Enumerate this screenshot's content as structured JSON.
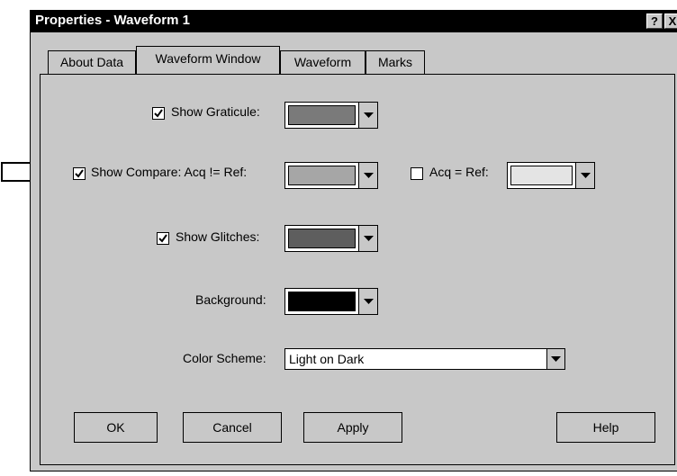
{
  "window": {
    "title": "Properties - Waveform 1",
    "help_glyph": "?",
    "close_glyph": "X"
  },
  "tabs": [
    {
      "label": "About Data",
      "active": false
    },
    {
      "label": "Waveform Window",
      "active": true
    },
    {
      "label": "Waveform",
      "active": false
    },
    {
      "label": "Marks",
      "active": false
    }
  ],
  "options": {
    "graticule": {
      "label": "Show Graticule:",
      "checked": true,
      "color": "#7a7a7a"
    },
    "compare": {
      "label": "Show Compare: Acq != Ref:",
      "checked": true,
      "color": "#a6a6a6"
    },
    "acq_eq_ref": {
      "label": "Acq = Ref:",
      "checked": false,
      "color": "#e4e4e4"
    },
    "glitches": {
      "label": "Show Glitches:",
      "checked": true,
      "color": "#5e5e5e"
    },
    "background": {
      "label": "Background:",
      "color": "#000000"
    },
    "color_scheme": {
      "label": "Color Scheme:",
      "value": "Light on Dark"
    }
  },
  "buttons": {
    "ok": "OK",
    "cancel": "Cancel",
    "apply": "Apply",
    "help": "Help"
  }
}
